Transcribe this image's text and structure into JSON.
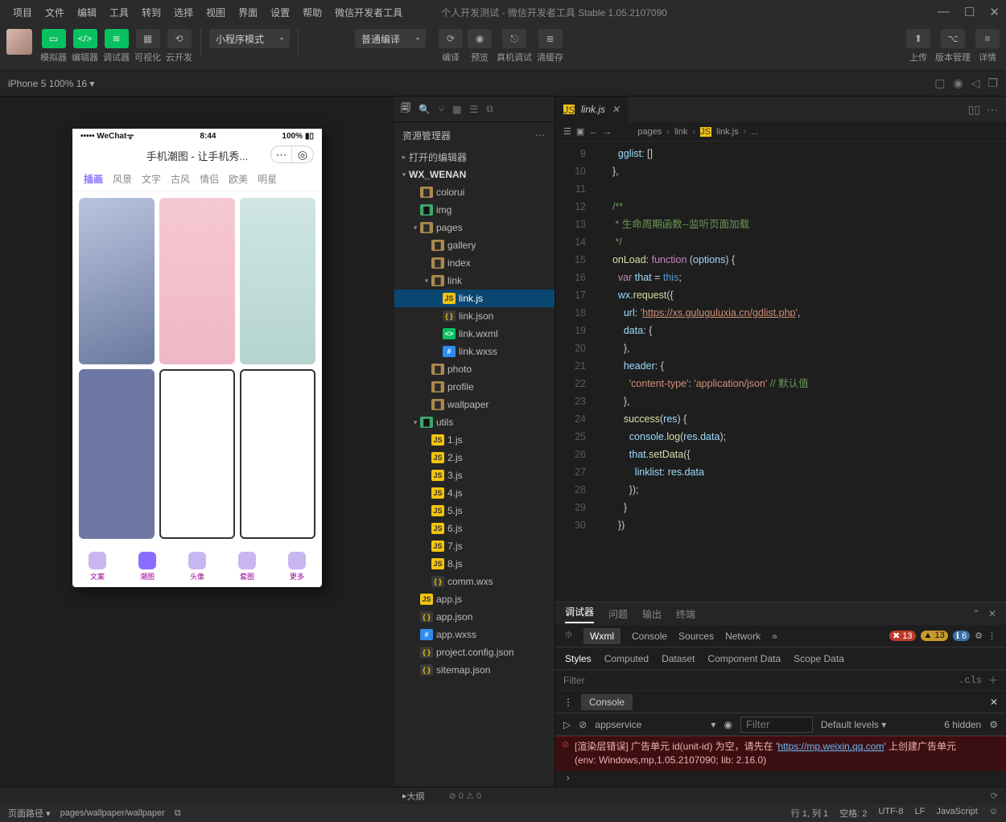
{
  "menu": {
    "items": [
      "项目",
      "文件",
      "编辑",
      "工具",
      "转到",
      "选择",
      "视图",
      "界面",
      "设置",
      "帮助",
      "微信开发者工具"
    ],
    "title": "个人开发测试 - 微信开发者工具 Stable 1.05.2107090"
  },
  "toolbar": {
    "labels": {
      "sim": "模拟器",
      "editor": "编辑器",
      "debugger": "调试器",
      "visual": "可视化",
      "cloud": "云开发"
    },
    "mode": "小程序模式",
    "compile": "普通编译",
    "actions": {
      "compile": "编译",
      "preview": "预览",
      "remote": "真机调试",
      "clear": "清缓存",
      "upload": "上传",
      "version": "版本管理",
      "details": "详情"
    }
  },
  "tabrow": {
    "device": "iPhone 5 100% 16 ▾"
  },
  "phone": {
    "carrier": "••••• WeChat",
    "wifi": "ᯤ",
    "time": "8:44",
    "battery": "100%",
    "title": "手机潮图 - 让手机秀...",
    "tabs": [
      "插画",
      "风景",
      "文字",
      "古风",
      "情侣",
      "欧美",
      "明星"
    ],
    "bottom": [
      "文案",
      "潮图",
      "头像",
      "套图",
      "更多"
    ]
  },
  "explorer": {
    "title": "资源管理器",
    "sections": {
      "open": "打开的编辑器",
      "proj": "WX_WENAN"
    },
    "tree": [
      {
        "l": 1,
        "t": "folder",
        "n": "colorui"
      },
      {
        "l": 1,
        "t": "folderg",
        "n": "img"
      },
      {
        "l": 1,
        "t": "folder",
        "n": "pages",
        "open": true,
        "children": [
          {
            "l": 2,
            "t": "folder",
            "n": "gallery"
          },
          {
            "l": 2,
            "t": "folder",
            "n": "index"
          },
          {
            "l": 2,
            "t": "folder",
            "n": "link",
            "open": true,
            "children": [
              {
                "l": 3,
                "t": "js",
                "n": "link.js",
                "sel": true
              },
              {
                "l": 3,
                "t": "json",
                "n": "link.json"
              },
              {
                "l": 3,
                "t": "wxml",
                "n": "link.wxml"
              },
              {
                "l": 3,
                "t": "wxss",
                "n": "link.wxss"
              }
            ]
          },
          {
            "l": 2,
            "t": "folder",
            "n": "photo"
          },
          {
            "l": 2,
            "t": "folder",
            "n": "profile"
          },
          {
            "l": 2,
            "t": "folder",
            "n": "wallpaper"
          }
        ]
      },
      {
        "l": 1,
        "t": "folderg",
        "n": "utils",
        "open": true,
        "children": [
          {
            "l": 2,
            "t": "js",
            "n": "1.js"
          },
          {
            "l": 2,
            "t": "js",
            "n": "2.js"
          },
          {
            "l": 2,
            "t": "js",
            "n": "3.js"
          },
          {
            "l": 2,
            "t": "js",
            "n": "4.js"
          },
          {
            "l": 2,
            "t": "js",
            "n": "5.js"
          },
          {
            "l": 2,
            "t": "js",
            "n": "6.js"
          },
          {
            "l": 2,
            "t": "js",
            "n": "7.js"
          },
          {
            "l": 2,
            "t": "js",
            "n": "8.js"
          },
          {
            "l": 2,
            "t": "json",
            "n": "comm.wxs"
          }
        ]
      },
      {
        "l": 1,
        "t": "js",
        "n": "app.js"
      },
      {
        "l": 1,
        "t": "json",
        "n": "app.json"
      },
      {
        "l": 1,
        "t": "wxss",
        "n": "app.wxss"
      },
      {
        "l": 1,
        "t": "json",
        "n": "project.config.json"
      },
      {
        "l": 1,
        "t": "json",
        "n": "sitemap.json"
      }
    ],
    "outline": "大纲"
  },
  "editor": {
    "tab": "link.js",
    "breadcrumb": [
      "pages",
      "link",
      "link.js",
      "..."
    ],
    "code_url": "https://xs.guluguluxia.cn/gdlist.php",
    "comment_line": "生命周期函数--监听页面加载",
    "default_cmt": "默认值"
  },
  "panels": {
    "top": [
      "调试器",
      "问题",
      "输出",
      "终端"
    ],
    "devtools": [
      "Wxml",
      "Console",
      "Sources",
      "Network"
    ],
    "badges": {
      "err": "13",
      "warn": "13",
      "info": "6"
    },
    "styles": [
      "Styles",
      "Computed",
      "Dataset",
      "Component Data",
      "Scope Data"
    ],
    "filter": "Filter",
    "cls": ".cls"
  },
  "console": {
    "tab": "Console",
    "service": "appservice",
    "filter_ph": "Filter",
    "levels": "Default levels ▾",
    "hidden": "6 hidden",
    "err1": "[渲染层错误] 广告单元 id(unit-id) 为空，请先在 '",
    "errlink": "https://mp.weixin.qq.com",
    "err1b": "' 上创建广告单元",
    "err2": "(env: Windows,mp,1.05.2107090; lib: 2.16.0)"
  },
  "status": {
    "left1": "页面路径 ▾",
    "left2": "pages/wallpaper/wallpaper",
    "ox": "⊘ 0 ⚠ 0",
    "right": [
      "行 1, 列 1",
      "空格: 2",
      "UTF-8",
      "LF",
      "JavaScript"
    ]
  }
}
